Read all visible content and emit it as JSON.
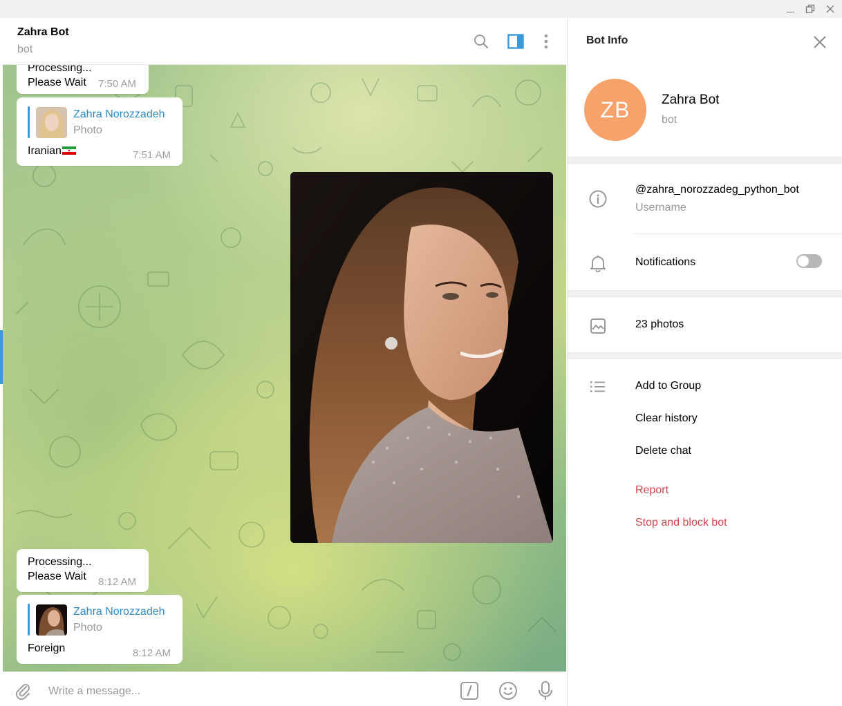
{
  "window": {
    "minimize_icon": "minimize-icon",
    "restore_icon": "restore-icon",
    "close_icon": "close-icon"
  },
  "chat_header": {
    "title": "Zahra Bot",
    "subtitle": "bot",
    "icons": [
      "search-icon",
      "sidebar-toggle-icon",
      "more-vert-icon"
    ],
    "accent_color": "#3a9ad9"
  },
  "messages": [
    {
      "type": "text",
      "text": "Processing...\nPlease Wait",
      "time": "7:50 AM"
    },
    {
      "type": "reply",
      "reply_name": "Zahra Norozzadeh",
      "reply_type": "Photo",
      "text": "Iranian",
      "emoji": "iran-flag",
      "time": "7:51 AM"
    },
    {
      "type": "photo",
      "description_icon": "portrait-photo"
    },
    {
      "type": "text",
      "text": "Processing...\nPlease Wait",
      "time": "8:12 AM"
    },
    {
      "type": "reply",
      "reply_name": "Zahra Norozzadeh",
      "reply_type": "Photo",
      "text": "Foreign",
      "time": "8:12 AM"
    }
  ],
  "composer": {
    "placeholder": "Write a message...",
    "icons": [
      "attach-icon",
      "bot-command-icon",
      "emoji-icon",
      "microphone-icon"
    ]
  },
  "info_panel": {
    "title": "Bot Info",
    "avatar_initials": "ZB",
    "avatar_color": "#f7a26b",
    "name": "Zahra Bot",
    "subtitle": "bot",
    "username": "@zahra_norozzadeg_python_bot",
    "username_label": "Username",
    "notifications_label": "Notifications",
    "notifications_enabled": false,
    "photos_label": "23 photos",
    "actions": {
      "add_to_group": "Add to Group",
      "clear_history": "Clear history",
      "delete_chat": "Delete chat",
      "report": "Report",
      "stop_block": "Stop and block bot"
    },
    "danger_color": "#d1474e"
  }
}
